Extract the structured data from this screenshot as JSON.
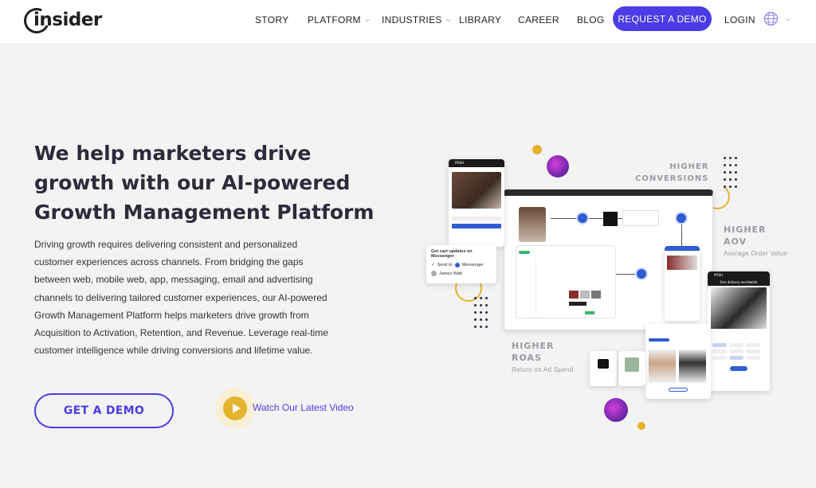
{
  "header": {
    "logo_text": "insider",
    "nav": [
      {
        "label": "STORY",
        "has_dropdown": false
      },
      {
        "label": "PLATFORM",
        "has_dropdown": true
      },
      {
        "label": "INDUSTRIES",
        "has_dropdown": true
      },
      {
        "label": "LIBRARY",
        "has_dropdown": false
      },
      {
        "label": "CAREER",
        "has_dropdown": false
      },
      {
        "label": "BLOG",
        "has_dropdown": false
      }
    ],
    "cta_label": "REQUEST A DEMO",
    "login_label": "LOGIN",
    "language_icon": "globe-icon"
  },
  "hero": {
    "title": "We help marketers drive growth with our AI-powered Growth Management Platform",
    "description": "Driving growth requires delivering consistent and personalized customer experiences across channels. From bridging the gaps between web, mobile web, app, messaging, email and advertising channels to delivering tailored customer experiences, our AI-powered Growth Management Platform helps marketers drive growth from Acquisition to Activation, Retention, and Revenue. Leverage real-time customer intelligence while driving conversions and lifetime value.",
    "cta_label": "GET A DEMO",
    "video_label": "Watch Our Latest Video"
  },
  "illustration": {
    "stats": [
      {
        "title_line1": "HIGHER",
        "title_line2": "CONVERSIONS",
        "subtitle": ""
      },
      {
        "title_line1": "HIGHER",
        "title_line2": "AOV",
        "subtitle": "Average Order Value"
      },
      {
        "title_line1": "HIGHER",
        "title_line2": "ROAS",
        "subtitle": "Return on Ad Spend"
      }
    ],
    "messenger_card": {
      "title": "Get cart updates on Messenger",
      "send_to": "Send to",
      "messenger": "Messenger",
      "user": "James Watt"
    },
    "phone_brand": "POSH",
    "phone_promo": "free delivery worldwide",
    "colors": {
      "accent": "#4b3ce6",
      "gold": "#e6b32e",
      "node_blue": "#2f5bd3",
      "dark": "#2b2b3a"
    }
  }
}
